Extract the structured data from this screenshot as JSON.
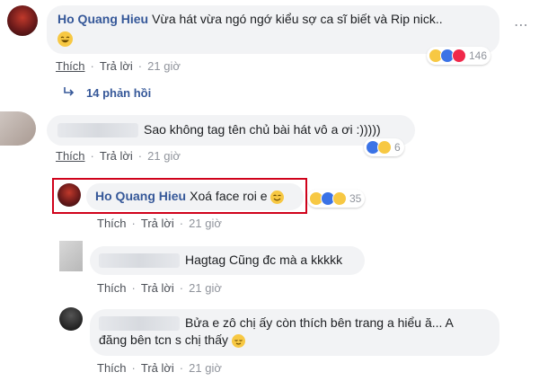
{
  "comment1": {
    "author": "Ho Quang Hieu",
    "text": "Vừa hát vừa ngó ngớ kiểu sợ ca sĩ biết và Rip nick..",
    "like": "Thích",
    "reply": "Trả lời",
    "time": "21 giờ",
    "reaction_count": "146",
    "replies_link": "14 phản hồi"
  },
  "comment2": {
    "text": "Sao không tag tên chủ bài hát vô a ơi :)))))",
    "like": "Thích",
    "reply": "Trả lời",
    "time": "21 giờ",
    "reaction_count": "6"
  },
  "reply1": {
    "author": "Ho Quang Hieu",
    "text": "Xoá face roi e",
    "like": "Thích",
    "reply": "Trả lời",
    "time": "21 giờ",
    "reaction_count": "35",
    "highlight_color": "#d0021b"
  },
  "reply2": {
    "text": "Hagtag Cũng đc mà a kkkkk",
    "like": "Thích",
    "reply": "Trả lời",
    "time": "21 giờ"
  },
  "reply3": {
    "text_line1": "Bửa e zô chị ấy còn thích bên trang a hiểu ă... A",
    "text_line2": "đăng bên tcn s chị thấy",
    "like": "Thích",
    "reply": "Trả lời",
    "time": "21 giờ"
  },
  "icons": [
    "more-icon",
    "reply-arrow-icon",
    "haha-icon",
    "like-icon",
    "love-icon",
    "smile-emoji-icon"
  ]
}
